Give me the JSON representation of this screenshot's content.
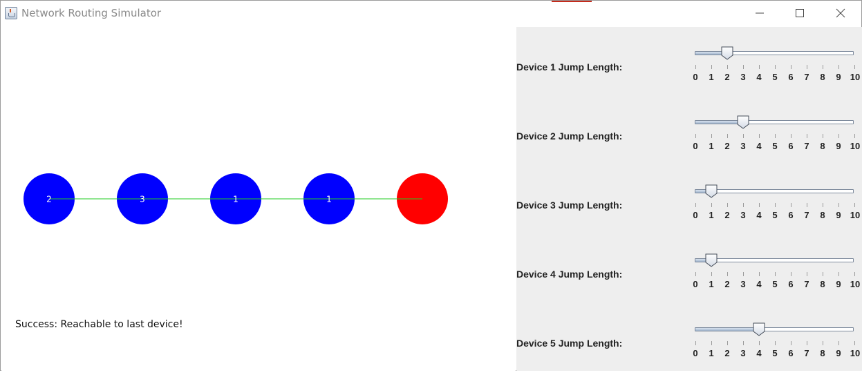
{
  "window": {
    "title": "Network Routing Simulator",
    "controls": [
      "minimize",
      "maximize",
      "close"
    ]
  },
  "canvas": {
    "nodes": [
      {
        "label": "2",
        "color": "#0000ff"
      },
      {
        "label": "3",
        "color": "#0000ff"
      },
      {
        "label": "1",
        "color": "#0000ff"
      },
      {
        "label": "1",
        "color": "#0000ff"
      },
      {
        "label": "",
        "color": "#ff0000"
      }
    ],
    "link_color": "#22cc22",
    "status": "Success: Reachable to last device!"
  },
  "controls": {
    "min": 0,
    "max": 10,
    "tick_labels": [
      "0",
      "1",
      "2",
      "3",
      "4",
      "5",
      "6",
      "7",
      "8",
      "9",
      "10"
    ],
    "sliders": [
      {
        "label": "Device 1 Jump Length:",
        "value": 2
      },
      {
        "label": "Device 2 Jump Length:",
        "value": 3
      },
      {
        "label": "Device 3 Jump Length:",
        "value": 1
      },
      {
        "label": "Device 4 Jump Length:",
        "value": 1
      },
      {
        "label": "Device 5 Jump Length:",
        "value": 4
      }
    ]
  },
  "icons": {
    "app": "java-cup-icon",
    "minimize": "minimize-icon",
    "maximize": "maximize-icon",
    "close": "close-icon"
  }
}
